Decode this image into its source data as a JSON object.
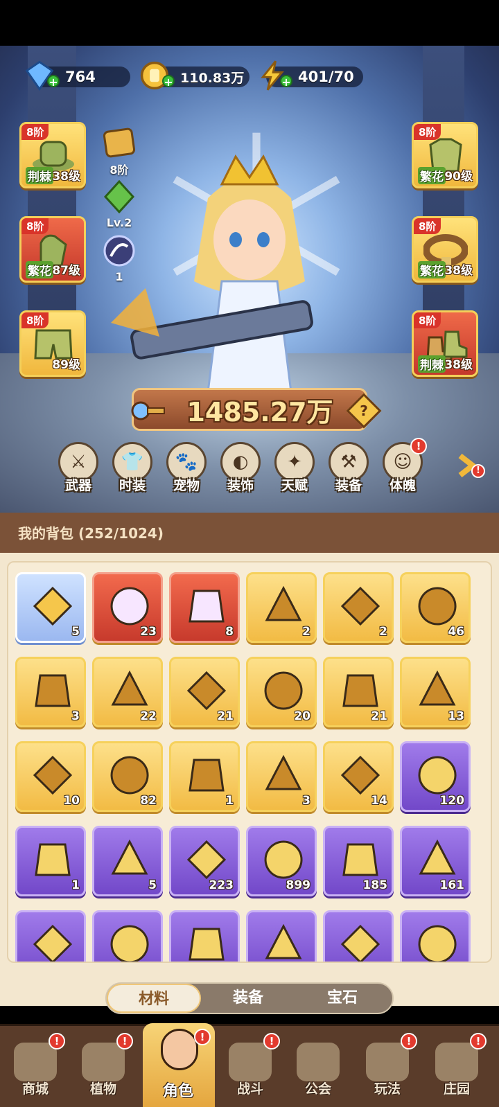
{
  "resources": [
    {
      "name": "gem",
      "value": "764",
      "icon": "diamond-icon"
    },
    {
      "name": "coin",
      "value": "110.83万",
      "icon": "coin-icon"
    },
    {
      "name": "energy",
      "value": "401/70",
      "icon": "lightning-icon"
    }
  ],
  "equipment_left": [
    {
      "tier": "8阶",
      "tag": "荆棘",
      "level": "38级",
      "color": "gold"
    },
    {
      "tier": "8阶",
      "tag": "繁花",
      "level": "87级",
      "color": "red"
    },
    {
      "tier": "8阶",
      "tag": "",
      "level": "89级",
      "color": "gold"
    }
  ],
  "equipment_right": [
    {
      "tier": "8阶",
      "tag": "繁花",
      "level": "90级",
      "color": "gold"
    },
    {
      "tier": "8阶",
      "tag": "繁花",
      "level": "38级",
      "color": "gold"
    },
    {
      "tier": "8阶",
      "tag": "荆棘",
      "level": "38级",
      "color": "red"
    }
  ],
  "mid_badges": {
    "tier": "8阶",
    "level": "Lv.2",
    "count": "1"
  },
  "power": "1485.27万",
  "help_label": "?",
  "menu": [
    {
      "label": "武器",
      "icon": "weapon-icon",
      "alert": false
    },
    {
      "label": "时装",
      "icon": "outfit-icon",
      "alert": false
    },
    {
      "label": "宠物",
      "icon": "pet-icon",
      "alert": false
    },
    {
      "label": "装饰",
      "icon": "mask-icon",
      "alert": false
    },
    {
      "label": "天赋",
      "icon": "talent-icon",
      "alert": false
    },
    {
      "label": "装备",
      "icon": "equipment-icon",
      "alert": false
    },
    {
      "label": "体魄",
      "icon": "physique-icon",
      "alert": true
    }
  ],
  "alert_mark": "!",
  "bag": {
    "title": "我的背包 (252/1024)",
    "items": [
      {
        "count": "5",
        "rarity": "blue",
        "icon": "star-icon"
      },
      {
        "count": "23",
        "rarity": "red",
        "icon": "crystal-star-icon"
      },
      {
        "count": "8",
        "rarity": "red",
        "icon": "potion-apple-icon"
      },
      {
        "count": "2",
        "rarity": "gold",
        "icon": "water-drop-icon"
      },
      {
        "count": "2",
        "rarity": "gold",
        "icon": "key-icon"
      },
      {
        "count": "46",
        "rarity": "gold",
        "icon": "prism-icon"
      },
      {
        "count": "3",
        "rarity": "gold",
        "icon": "golden-flower-icon"
      },
      {
        "count": "22",
        "rarity": "gold",
        "icon": "rune-stone-icon"
      },
      {
        "count": "21",
        "rarity": "gold",
        "icon": "orange-potion-icon"
      },
      {
        "count": "20",
        "rarity": "gold",
        "icon": "gold-ore-icon"
      },
      {
        "count": "21",
        "rarity": "gold",
        "icon": "red-flower-icon"
      },
      {
        "count": "13",
        "rarity": "gold",
        "icon": "flower-pot-icon"
      },
      {
        "count": "10",
        "rarity": "gold",
        "icon": "sprayer-icon"
      },
      {
        "count": "82",
        "rarity": "gold",
        "icon": "book-icon"
      },
      {
        "count": "1",
        "rarity": "gold",
        "icon": "map-icon"
      },
      {
        "count": "3",
        "rarity": "gold",
        "icon": "lily-icon"
      },
      {
        "count": "14",
        "rarity": "gold",
        "icon": "knot-icon"
      },
      {
        "count": "120",
        "rarity": "purple",
        "icon": "purple-potion-icon"
      },
      {
        "count": "1",
        "rarity": "purple",
        "icon": "silver-key-icon"
      },
      {
        "count": "5",
        "rarity": "purple",
        "icon": "emblem-icon"
      },
      {
        "count": "223",
        "rarity": "purple",
        "icon": "leaf-icon"
      },
      {
        "count": "899",
        "rarity": "purple",
        "icon": "scroll-green-icon"
      },
      {
        "count": "185",
        "rarity": "purple",
        "icon": "scroll-purple-icon"
      },
      {
        "count": "161",
        "rarity": "purple",
        "icon": "scroll-blue-icon"
      },
      {
        "count": "",
        "rarity": "purple",
        "icon": "red-item-icon"
      },
      {
        "count": "",
        "rarity": "purple",
        "icon": "gold-item-icon"
      },
      {
        "count": "",
        "rarity": "purple",
        "icon": "potion-icon"
      },
      {
        "count": "",
        "rarity": "purple",
        "icon": "blue-flower-icon"
      },
      {
        "count": "",
        "rarity": "purple",
        "icon": "purple-flower-icon"
      },
      {
        "count": "",
        "rarity": "purple",
        "icon": "cup-icon"
      }
    ]
  },
  "tabs": [
    {
      "label": "材料",
      "active": true
    },
    {
      "label": "装备",
      "active": false
    },
    {
      "label": "宝石",
      "active": false
    }
  ],
  "nav": [
    {
      "label": "商城",
      "alert": true,
      "active": false
    },
    {
      "label": "植物",
      "alert": true,
      "active": false
    },
    {
      "label": "角色",
      "alert": true,
      "active": true
    },
    {
      "label": "战斗",
      "alert": true,
      "active": false
    },
    {
      "label": "公会",
      "alert": false,
      "active": false
    },
    {
      "label": "玩法",
      "alert": true,
      "active": false
    },
    {
      "label": "庄园",
      "alert": true,
      "active": false
    }
  ],
  "colors": {
    "gold": "#f2bb44",
    "red": "#c73a2c",
    "purple": "#7248c9",
    "blue": "#9bb8f0",
    "wood": "#7b5238"
  }
}
